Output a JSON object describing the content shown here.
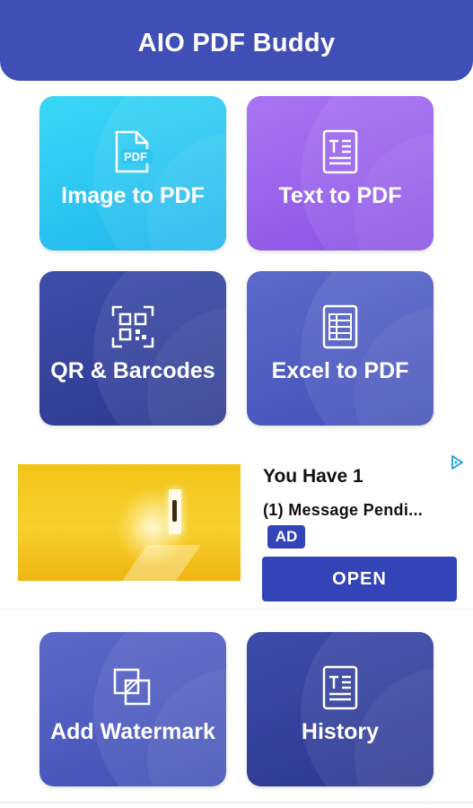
{
  "app": {
    "title": "AIO PDF Buddy"
  },
  "tiles": [
    {
      "label": "Image to PDF",
      "icon": "pdf-file-icon",
      "gradient": [
        "#36d4f5",
        "#22b9ee"
      ]
    },
    {
      "label": "Text to PDF",
      "icon": "text-document-icon",
      "gradient": [
        "#a56ef0",
        "#8c55e6"
      ]
    },
    {
      "label": "QR & Barcodes",
      "icon": "qr-code-icon",
      "gradient": [
        "#3d4ba8",
        "#2c3a93"
      ]
    },
    {
      "label": "Excel to PDF",
      "icon": "spreadsheet-icon",
      "gradient": [
        "#5b68c8",
        "#4655bb"
      ]
    },
    {
      "label": "Add Watermark",
      "icon": "watermark-icon",
      "gradient": [
        "#5966c6",
        "#4452b8"
      ]
    },
    {
      "label": "History",
      "icon": "history-document-icon",
      "gradient": [
        "#3c49a6",
        "#2c3993"
      ]
    }
  ],
  "ad": {
    "headline": "You Have 1",
    "body": "(1) Message Pendi...",
    "badge": "AD",
    "cta": "OPEN",
    "adchoices_icon": "adchoices-icon"
  },
  "colors": {
    "header": "#3f4fb5",
    "ad_button": "#3343b8"
  }
}
